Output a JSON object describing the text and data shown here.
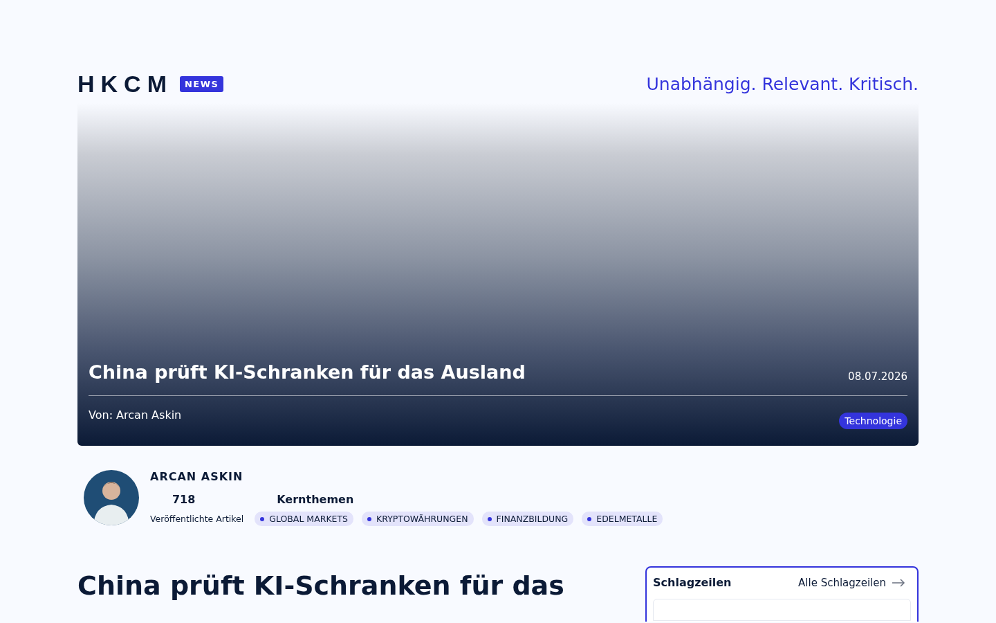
{
  "header": {
    "logo": "HKCM",
    "logo_badge": "NEWS",
    "tagline": "Unabhängig. Relevant. Kritisch."
  },
  "hero": {
    "title": "China prüft KI-Schranken für das Ausland",
    "date": "08.07.2026",
    "byline": "Von: Arcan Askin",
    "category": "Technologie"
  },
  "author": {
    "name": "ARCAN ASKIN",
    "article_count": "718",
    "article_count_label": "Veröffentlichte Artikel",
    "topics_heading": "Kernthemen",
    "topics": [
      "GLOBAL MARKETS",
      "KRYPTOWÄHRUNGEN",
      "FINANZBILDUNG",
      "EDELMETALLE"
    ]
  },
  "article": {
    "title": "China prüft KI-Schranken für das"
  },
  "headlines": {
    "title": "Schlagzeilen",
    "link": "Alle Schlagzeilen"
  }
}
